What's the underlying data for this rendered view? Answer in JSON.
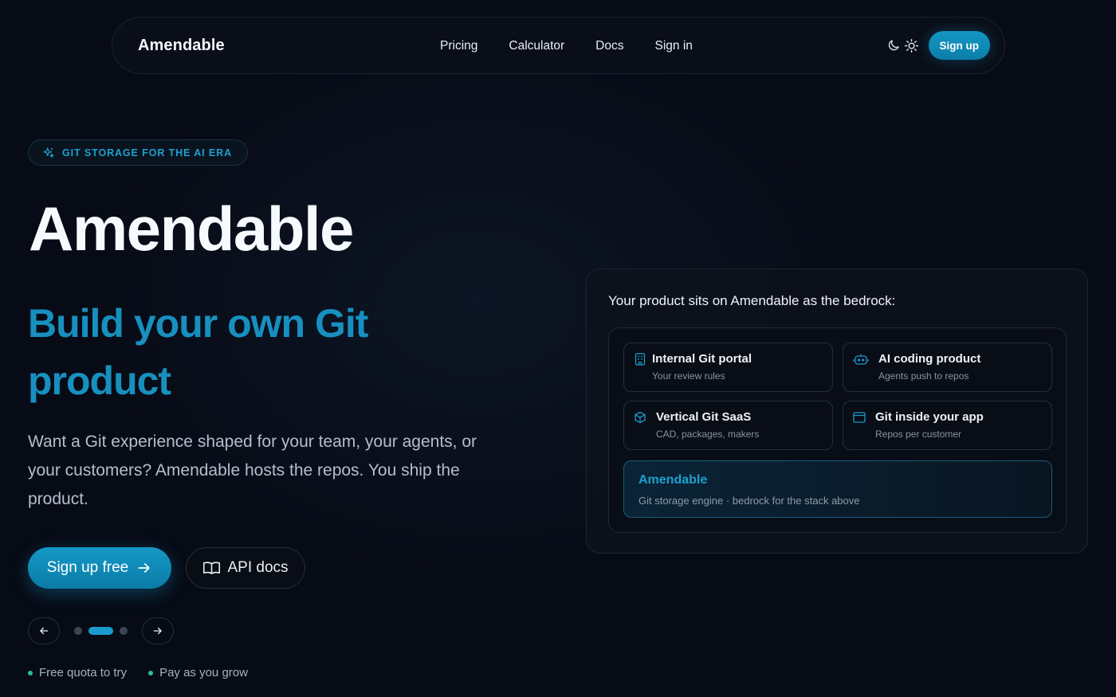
{
  "nav": {
    "brand": "Amendable",
    "links": [
      "Pricing",
      "Calculator",
      "Docs",
      "Sign in"
    ],
    "signup_label": "Sign up",
    "theme_icons": [
      "moon-icon",
      "sun-icon"
    ]
  },
  "badge": {
    "icon": "sparkle-icon",
    "text": "GIT STORAGE FOR THE AI ERA"
  },
  "hero": {
    "title": "Amendable",
    "subtitle_line1": "Build your own Git",
    "subtitle_line2": "product",
    "description": "Want a Git experience shaped for your team, your agents, or your customers? Amendable hosts the repos. You ship the product."
  },
  "cta": {
    "primary_label": "Sign up free",
    "secondary_label": "API docs"
  },
  "carousel": {
    "slide_count": 3,
    "active_index": 1
  },
  "perks": [
    "Free quota to try",
    "Pay as you grow"
  ],
  "panel": {
    "heading": "Your product sits on Amendable as the bedrock:",
    "cards": [
      {
        "icon": "server-icon",
        "title": "Internal Git portal",
        "desc": "Your review rules"
      },
      {
        "icon": "robot-icon",
        "title": "AI coding product",
        "desc": "Agents push to repos"
      },
      {
        "icon": "cube-icon",
        "title": "Vertical Git SaaS",
        "desc": "CAD, packages, makers"
      },
      {
        "icon": "app-window-icon",
        "title": "Git inside your app",
        "desc": "Repos per customer"
      }
    ],
    "engine": {
      "title": "Amendable",
      "desc": "Git storage engine · bedrock for the stack above"
    }
  },
  "colors": {
    "background": "#070b16",
    "accent": "#1596c4",
    "accent_text": "#1790bf",
    "success": "#22c48e"
  }
}
